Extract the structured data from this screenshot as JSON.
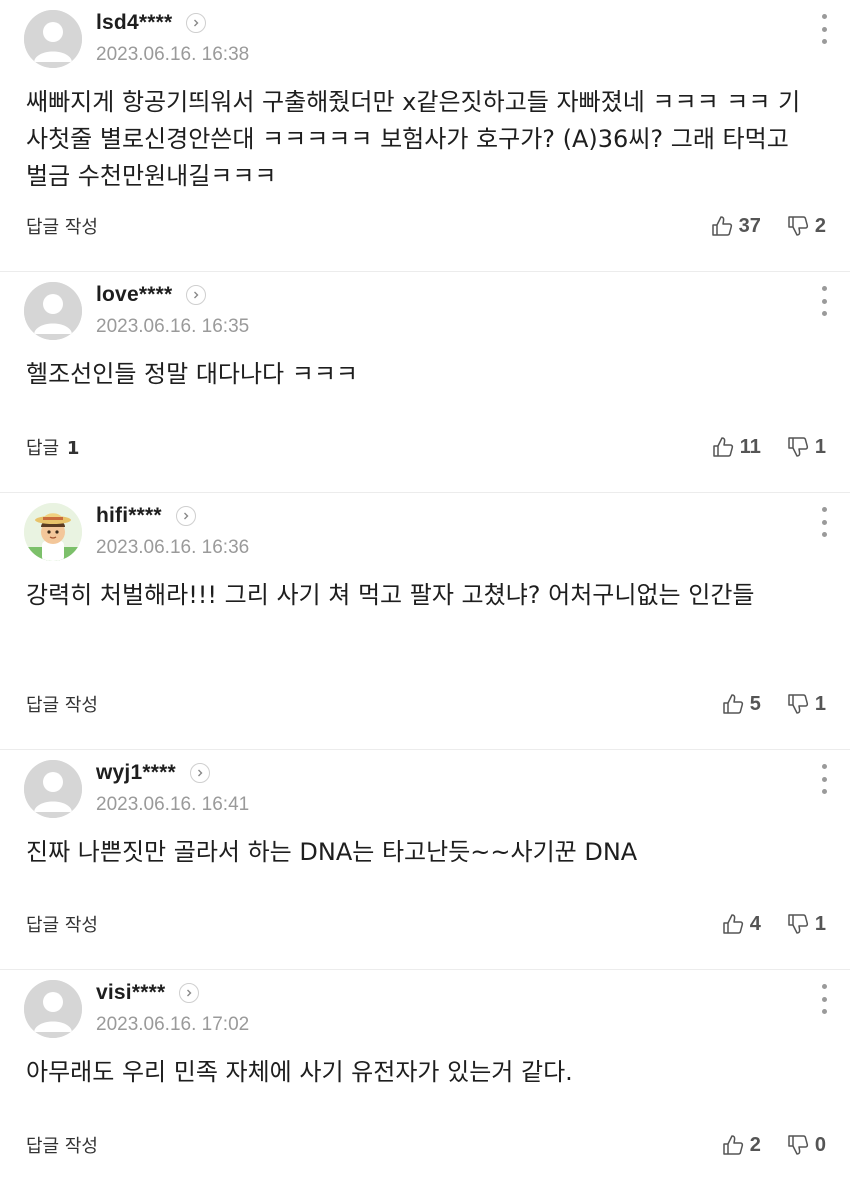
{
  "comments": [
    {
      "nickname": "lsd4****",
      "date": "2023.06.16. 16:38",
      "text": "쌔빠지게 항공기띄워서 구출해줬더만 x같은짓하고들 자빠졌네 ㅋㅋㅋ ㅋㅋ 기사첫줄 별로신경안쓴대 ㅋㅋㅋㅋㅋ 보험사가 호구가? (A)36씨? 그래 타먹고 벌금 수천만원내길ㅋㅋㅋ",
      "reply_label": "답글 작성",
      "reply_count": "",
      "likes": "37",
      "dislikes": "2",
      "avatar": "default"
    },
    {
      "nickname": "love****",
      "date": "2023.06.16. 16:35",
      "text": "헬조선인들 정말 대다나다 ㅋㅋㅋ",
      "reply_label": "답글",
      "reply_count": "1",
      "likes": "11",
      "dislikes": "1",
      "avatar": "default"
    },
    {
      "nickname": "hifi****",
      "date": "2023.06.16. 16:36",
      "text": "강력히 처벌해라!!! 그리 사기 쳐 먹고 팔자 고쳤냐? 어처구니없는 인간들",
      "reply_label": "답글 작성",
      "reply_count": "",
      "likes": "5",
      "dislikes": "1",
      "avatar": "character"
    },
    {
      "nickname": "wyj1****",
      "date": "2023.06.16. 16:41",
      "text": "진짜 나쁜짓만 골라서 하는 DNA는 타고난듯~~사기꾼 DNA",
      "reply_label": "답글 작성",
      "reply_count": "",
      "likes": "4",
      "dislikes": "1",
      "avatar": "default"
    },
    {
      "nickname": "visi****",
      "date": "2023.06.16. 17:02",
      "text": "아무래도 우리 민족 자체에 사기 유전자가 있는거 같다.",
      "reply_label": "답글 작성",
      "reply_count": "",
      "likes": "2",
      "dislikes": "0",
      "avatar": "default"
    }
  ],
  "icons": {
    "like": "thumbs-up-icon",
    "dislike": "thumbs-down-icon",
    "more": "more-vertical-icon",
    "profile": "chevron-right-icon"
  },
  "colors": {
    "text": "#1e1e1e",
    "meta": "#9a9a9a",
    "divider": "#ececec"
  }
}
